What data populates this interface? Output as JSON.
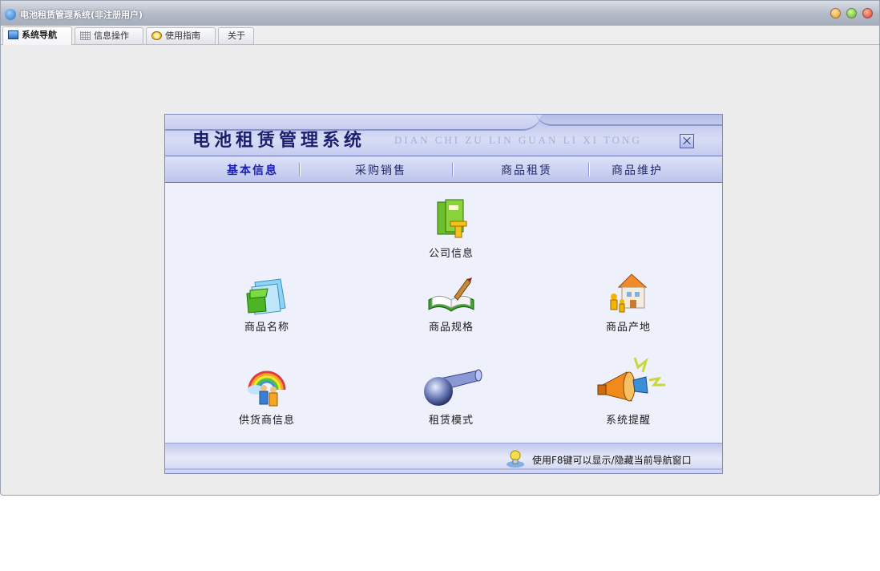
{
  "window": {
    "title": "电池租赁管理系统(非注册用户)",
    "controls": [
      "minimize",
      "maximize",
      "close"
    ]
  },
  "tabs": [
    {
      "label": "系统导航",
      "icon": "monitor-icon",
      "active": true
    },
    {
      "label": "信息操作",
      "icon": "grid-icon",
      "active": false
    },
    {
      "label": "使用指南",
      "icon": "guide-icon",
      "active": false
    },
    {
      "label": "关于",
      "icon": "",
      "active": false
    }
  ],
  "panel": {
    "title": "电池租赁管理系统",
    "subtitle": "DIAN CHI ZU LIN GUAN LI XI TONG",
    "nav": [
      {
        "label": "基本信息",
        "active": true
      },
      {
        "label": "采购销售",
        "active": false
      },
      {
        "label": "商品租赁",
        "active": false
      },
      {
        "label": "商品维护",
        "active": false
      }
    ],
    "items": [
      {
        "label": "公司信息",
        "icon": "books-icon"
      },
      {
        "label": "商品名称",
        "icon": "folder-icon"
      },
      {
        "label": "商品规格",
        "icon": "open-book-icon"
      },
      {
        "label": "商品产地",
        "icon": "house-icon"
      },
      {
        "label": "供货商信息",
        "icon": "rainbow-people-icon"
      },
      {
        "label": "租赁模式",
        "icon": "globe-pipe-icon"
      },
      {
        "label": "系统提醒",
        "icon": "megaphone-icon"
      }
    ],
    "footer_hint": "使用F8键可以显示/隐藏当前导航窗口"
  },
  "colors": {
    "panel_bg": "#eef1fb",
    "panel_border": "#7f8cc4",
    "title_color": "#1b1f6e",
    "nav_active": "#1a1fb0"
  }
}
